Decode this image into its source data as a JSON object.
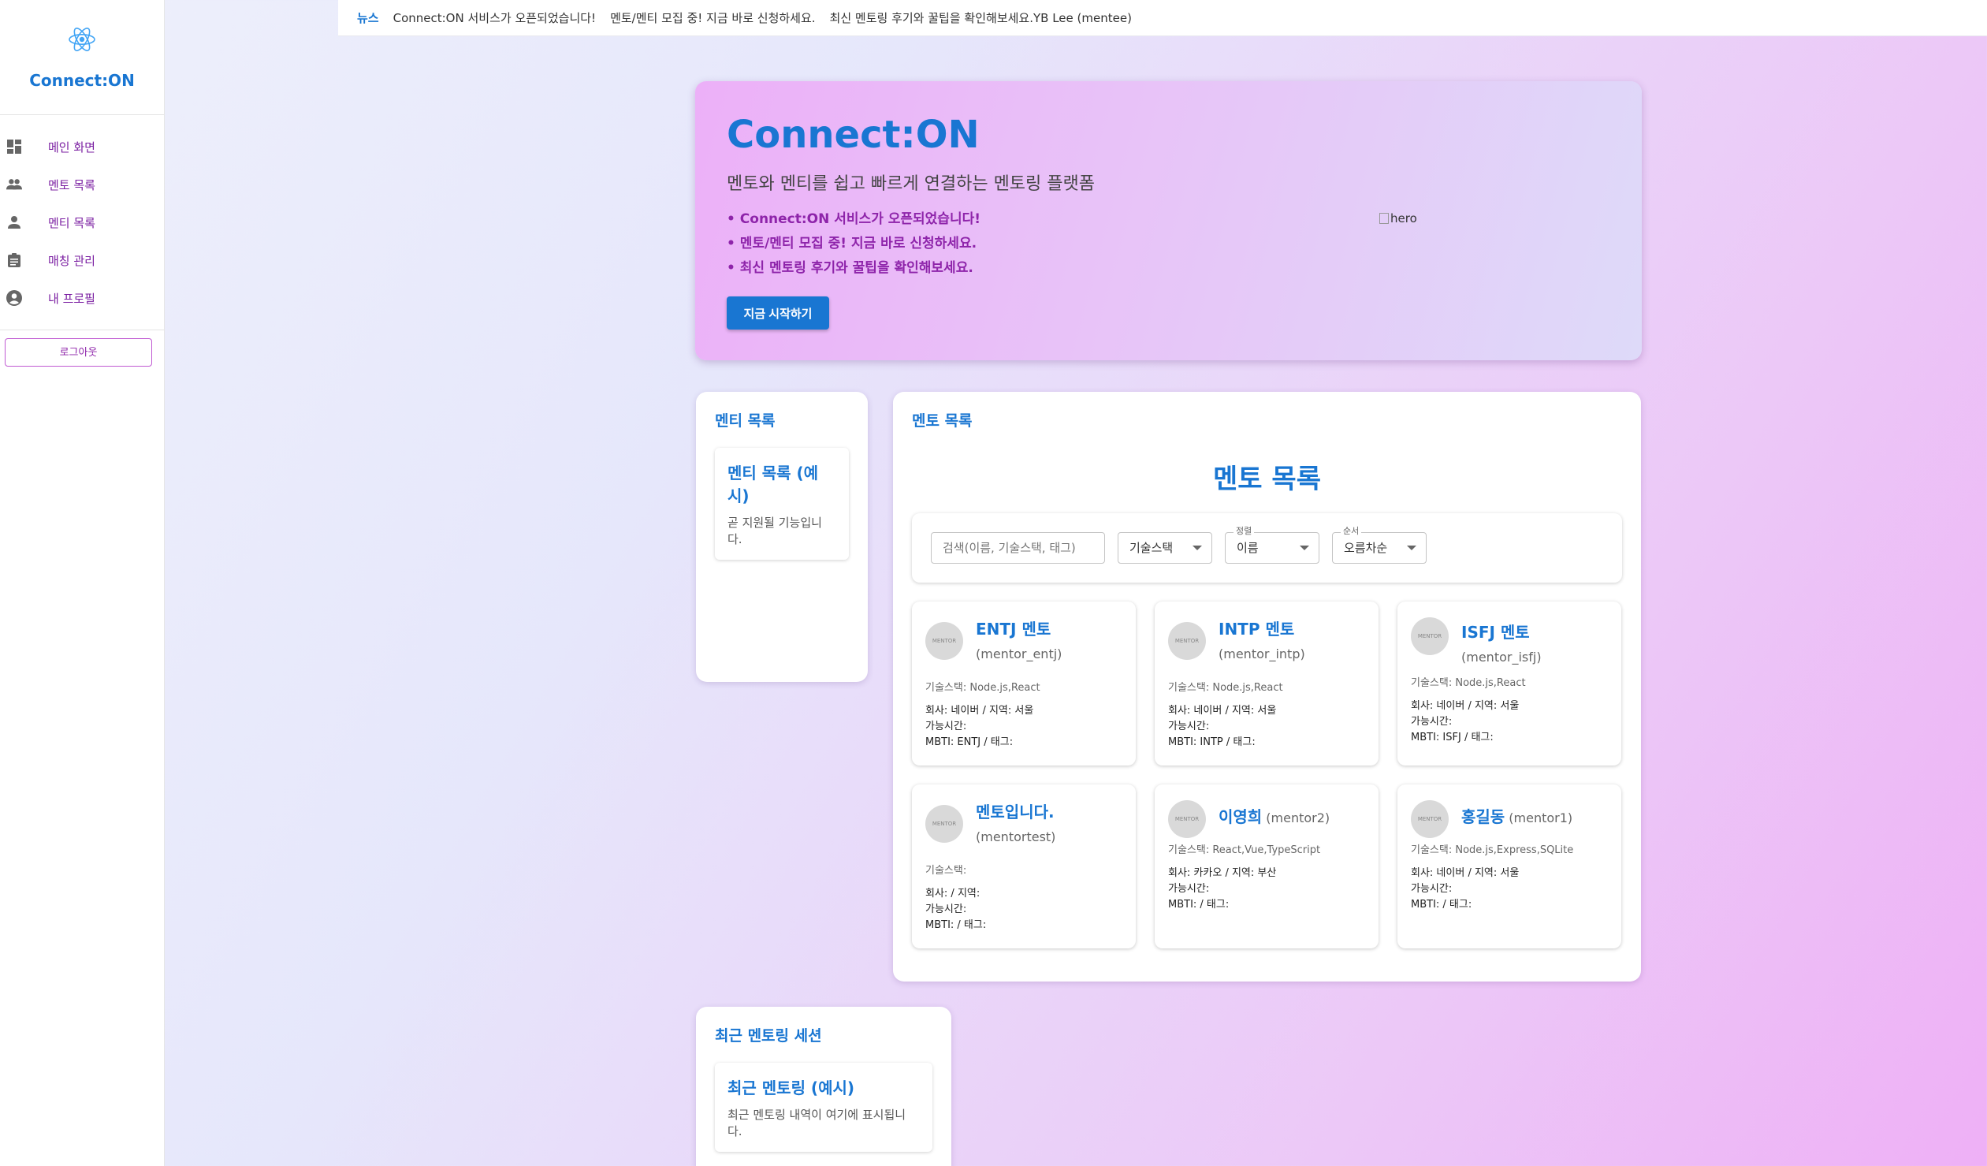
{
  "sidebar": {
    "brand": "Connect:ON",
    "items": [
      {
        "label": "메인 화면",
        "icon": "dashboard-icon"
      },
      {
        "label": "멘토 목록",
        "icon": "people-icon"
      },
      {
        "label": "멘티 목록",
        "icon": "person-icon"
      },
      {
        "label": "매칭 관리",
        "icon": "assignment-icon"
      },
      {
        "label": "내 프로필",
        "icon": "account-circle-icon"
      }
    ],
    "logout_label": "로그아웃"
  },
  "news": {
    "title": "뉴스",
    "items": [
      "Connect:ON 서비스가 오픈되었습니다!",
      "멘토/멘티 모집 중! 지금 바로 신청하세요.",
      "최신 멘토링 후기와 꿀팁을 확인해보세요.YB Lee (mentee)"
    ]
  },
  "hero": {
    "title": "Connect:ON",
    "subtitle": "멘토와 멘티를 쉽고 빠르게 연결하는 멘토링 플랫폼",
    "bullets": [
      "• Connect:ON 서비스가 오픈되었습니다!",
      "• 멘토/멘티 모집 중! 지금 바로 신청하세요.",
      "• 최신 멘토링 후기와 꿀팁을 확인해보세요."
    ],
    "button_label": "지금 시작하기",
    "image_alt": "hero"
  },
  "mentee_panel": {
    "title": "멘티 목록",
    "card_title": "멘티 목록 (예시)",
    "card_desc": "곧 지원될 기능입니다."
  },
  "mentor_panel": {
    "title": "멘토 목록",
    "heading": "멘토 목록",
    "search_placeholder": "검색(이름, 기술스택, 태그)",
    "skill_select": "기술스택",
    "sort_label": "정렬",
    "sort_value": "이름",
    "order_label": "순서",
    "order_value": "오름차순",
    "mentors": [
      {
        "name": "ENTJ 멘토",
        "id": "(mentor_entj)",
        "skill": "기술스택: Node.js,React",
        "company": "회사: 네이버 / 지역: 서울",
        "time": "가능시간:",
        "mbti": "MBTI: ENTJ / 태그:"
      },
      {
        "name": "INTP 멘토",
        "id": "(mentor_intp)",
        "skill": "기술스택: Node.js,React",
        "company": "회사: 네이버 / 지역: 서울",
        "time": "가능시간:",
        "mbti": "MBTI: INTP / 태그:"
      },
      {
        "name": "ISFJ 멘토",
        "id": "(mentor_isfj)",
        "skill": "기술스택: Node.js,React",
        "company": "회사: 네이버 / 지역: 서울",
        "time": "가능시간:",
        "mbti": "MBTI: ISFJ / 태그:"
      },
      {
        "name": "멘토입니다.",
        "id": "(mentortest)",
        "skill": "기술스택:",
        "company": "회사: / 지역:",
        "time": "가능시간:",
        "mbti": "MBTI: / 태그:"
      },
      {
        "name": "이영희",
        "id": "(mentor2)",
        "skill": "기술스택: React,Vue,TypeScript",
        "company": "회사: 카카오 / 지역: 부산",
        "time": "가능시간:",
        "mbti": "MBTI: / 태그:"
      },
      {
        "name": "홍길동",
        "id": "(mentor1)",
        "skill": "기술스택: Node.js,Express,SQLite",
        "company": "회사: 네이버 / 지역: 서울",
        "time": "가능시간:",
        "mbti": "MBTI: / 태그:"
      }
    ],
    "avatar_text": "MENTOR"
  },
  "recent_panel": {
    "title": "최근 멘토링 세션",
    "card_title": "최근 멘토링 (예시)",
    "card_desc": "최근 멘토링 내역이 여기에 표시됩니다."
  },
  "colors": {
    "primary": "#1976d2",
    "accent": "#8e24aa"
  }
}
